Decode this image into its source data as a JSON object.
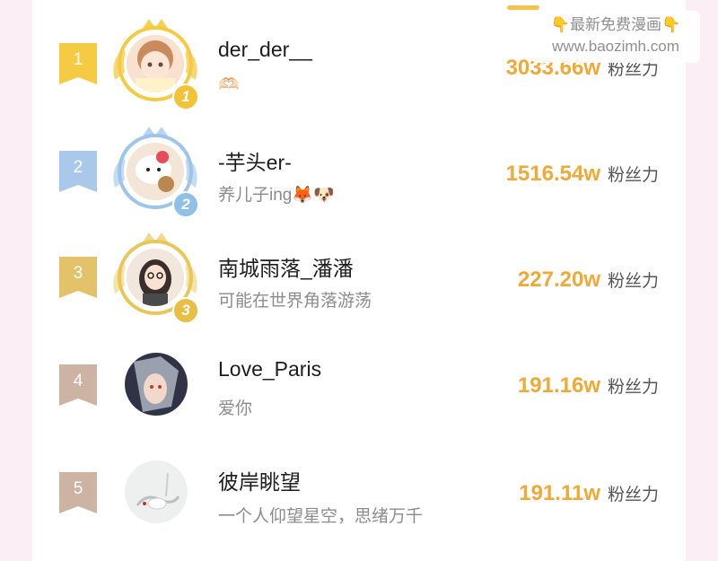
{
  "watermark": {
    "line1": "最新免费漫画",
    "line2": "www.baozimh.com",
    "hand_left": "👇",
    "hand_right": "👇"
  },
  "rows": [
    {
      "rank": "1",
      "medal": "1",
      "name": "der_der__",
      "signature": "🫶🏻",
      "fans_value": "3033.66w",
      "fans_label": "粉丝力",
      "ribbon_color": "#f6cb44"
    },
    {
      "rank": "2",
      "medal": "2",
      "name": "-芋头er-",
      "signature": "养儿子ing🦊🐶",
      "fans_value": "1516.54w",
      "fans_label": "粉丝力",
      "ribbon_color": "#a9c8ea"
    },
    {
      "rank": "3",
      "medal": "3",
      "name": "南城雨落_潘潘",
      "signature": "可能在世界角落游荡",
      "fans_value": "227.20w",
      "fans_label": "粉丝力",
      "ribbon_color": "#e3c36a"
    },
    {
      "rank": "4",
      "name": "Love_Paris",
      "signature": "爱你",
      "fans_value": "191.16w",
      "fans_label": "粉丝力",
      "ribbon_color": "#cdb4a2"
    },
    {
      "rank": "5",
      "name": "彼岸眺望",
      "signature": "一个人仰望星空，思绪万千",
      "fans_value": "191.11w",
      "fans_label": "粉丝力",
      "ribbon_color": "#cdb4a2"
    }
  ],
  "colors": {
    "accent": "#f0a935",
    "gold_medal": "#f4c236",
    "silver_medal": "#8ec0ea",
    "bronze_medal": "#e8be45"
  }
}
